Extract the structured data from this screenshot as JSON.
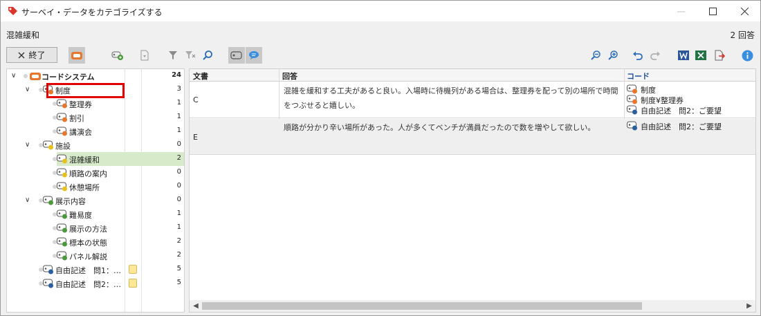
{
  "window": {
    "title": "サーベイ・データをカテゴライズする"
  },
  "header": {
    "code_name": "混雑緩和",
    "answer_count": "2 回答"
  },
  "toolbar": {
    "end_label": "終了"
  },
  "tree": {
    "rows": [
      {
        "label": "コードシステム",
        "count": "24",
        "level": 0,
        "expander": true,
        "root": true,
        "color": "#e8772e"
      },
      {
        "label": "制度",
        "count": "3",
        "level": 1,
        "expander": true,
        "color": "#e8772e"
      },
      {
        "label": "整理券",
        "count": "1",
        "level": 2,
        "color": "#e8772e"
      },
      {
        "label": "割引",
        "count": "1",
        "level": 2,
        "color": "#e8772e"
      },
      {
        "label": "講演会",
        "count": "1",
        "level": 2,
        "color": "#e8772e"
      },
      {
        "label": "施設",
        "count": "0",
        "level": 1,
        "expander": true,
        "color": "#e8c21c"
      },
      {
        "label": "混雑緩和",
        "count": "2",
        "level": 2,
        "color": "#e8c21c",
        "highlight": true
      },
      {
        "label": "順路の案内",
        "count": "0",
        "level": 2,
        "color": "#e8c21c"
      },
      {
        "label": "休憩場所",
        "count": "0",
        "level": 2,
        "color": "#e8c21c"
      },
      {
        "label": "展示内容",
        "count": "0",
        "level": 1,
        "expander": true,
        "color": "#4a9a3a"
      },
      {
        "label": "難易度",
        "count": "1",
        "level": 2,
        "color": "#4a9a3a"
      },
      {
        "label": "展示の方法",
        "count": "1",
        "level": 2,
        "color": "#4a9a3a"
      },
      {
        "label": "標本の状態",
        "count": "2",
        "level": 2,
        "color": "#4a9a3a"
      },
      {
        "label": "パネル解説",
        "count": "2",
        "level": 2,
        "color": "#4a9a3a"
      },
      {
        "label": "自由記述　問1：…",
        "count": "5",
        "level": 1,
        "color": "#2a5f9e",
        "memo": true
      },
      {
        "label": "自由記述　問2：…",
        "count": "5",
        "level": 1,
        "color": "#2a5f9e",
        "memo": true
      }
    ]
  },
  "table": {
    "headers": {
      "doc": "文書",
      "answer": "回答",
      "code": "コード"
    },
    "rows": [
      {
        "doc": "C",
        "answer": "混雑を緩和する工夫があると良い。入場時に待機列がある場合は、整理券を配って別の場所で時間をつぶせると嬉しい。",
        "codes": [
          {
            "label": "制度",
            "color": "#e8772e"
          },
          {
            "label": "制度¥整理券",
            "color": "#e8772e"
          },
          {
            "label": "自由記述　問2：ご要望",
            "color": "#2a5f9e"
          }
        ]
      },
      {
        "doc": "E",
        "answer": "順路が分かり辛い場所があった。人が多くてベンチが満員だったので数を増やして欲しい。",
        "codes": [
          {
            "label": "自由記述　問2：ご要望",
            "color": "#2a5f9e"
          }
        ]
      }
    ]
  }
}
